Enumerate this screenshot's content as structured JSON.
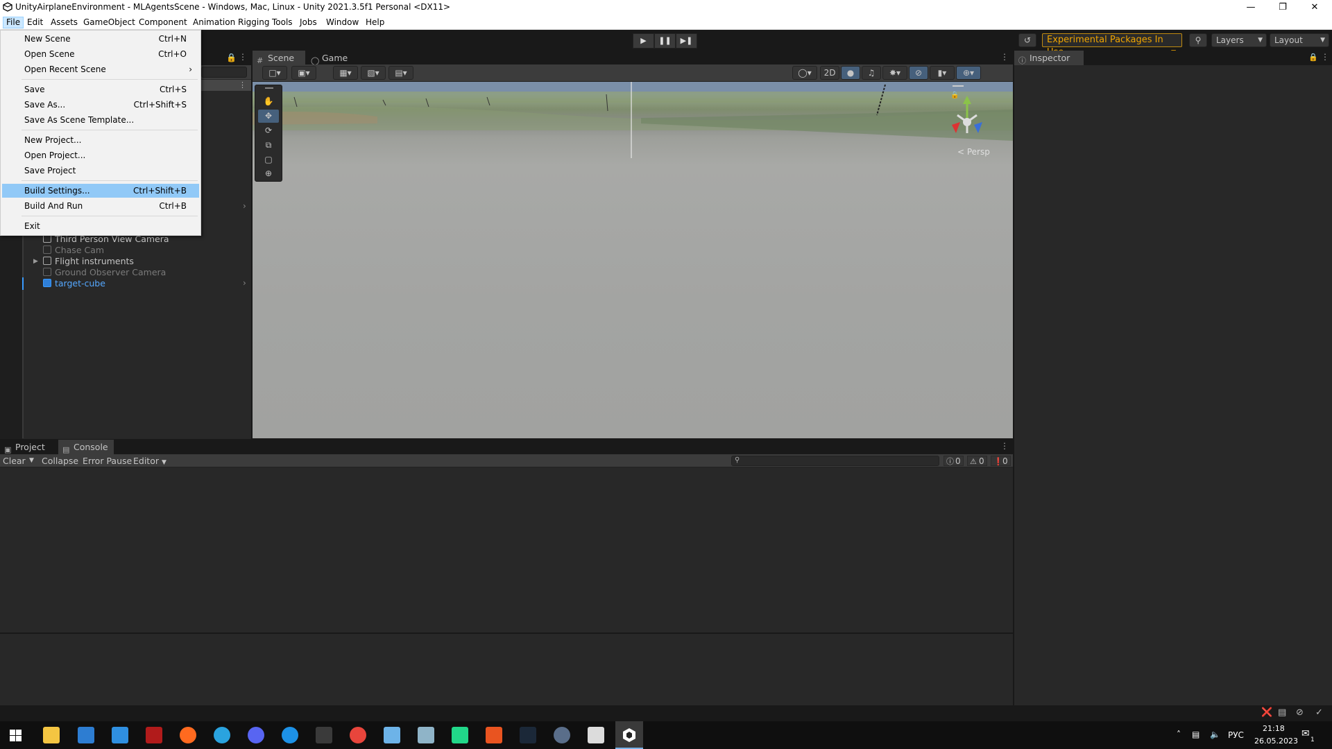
{
  "window": {
    "title": "UnityAirplaneEnvironment - MLAgentsScene - Windows, Mac, Linux - Unity 2021.3.5f1 Personal <DX11>"
  },
  "menubar": {
    "items": [
      "File",
      "Edit",
      "Assets",
      "GameObject",
      "Component",
      "Animation Rigging",
      "Tools",
      "Jobs",
      "Window",
      "Help"
    ]
  },
  "toolbar": {
    "experimental_label": "Experimental Packages In Use",
    "layers_label": "Layers",
    "layout_label": "Layout"
  },
  "file_menu": {
    "items": [
      {
        "label": "New Scene",
        "shortcut": "Ctrl+N"
      },
      {
        "label": "Open Scene",
        "shortcut": "Ctrl+O"
      },
      {
        "label": "Open Recent Scene",
        "shortcut": ""
      },
      {
        "label": "Save",
        "shortcut": "Ctrl+S"
      },
      {
        "label": "Save As...",
        "shortcut": "Ctrl+Shift+S"
      },
      {
        "label": "Save As Scene Template...",
        "shortcut": ""
      },
      {
        "label": "New Project...",
        "shortcut": ""
      },
      {
        "label": "Open Project...",
        "shortcut": ""
      },
      {
        "label": "Save Project",
        "shortcut": ""
      },
      {
        "label": "Build Settings...",
        "shortcut": "Ctrl+Shift+B"
      },
      {
        "label": "Build And Run",
        "shortcut": "Ctrl+B"
      },
      {
        "label": "Exit",
        "shortcut": ""
      }
    ]
  },
  "hierarchy": {
    "items": [
      {
        "label": "Third Person View Camera"
      },
      {
        "label": "Chase Cam"
      },
      {
        "label": "Flight instruments"
      },
      {
        "label": "Ground Observer Camera"
      },
      {
        "label": "target-cube"
      }
    ]
  },
  "scene": {
    "tabs": [
      "Scene",
      "Game"
    ],
    "btn_2d": "2D",
    "persp_label": "< Persp"
  },
  "inspector": {
    "tab": "Inspector"
  },
  "console": {
    "tabs": [
      "Project",
      "Console"
    ],
    "clear": "Clear",
    "collapse": "Collapse",
    "error_pause": "Error Pause",
    "editor": "Editor",
    "count_log": "0",
    "count_warn": "0",
    "count_error": "0"
  },
  "tray": {
    "lang": "РУС",
    "time": "21:18",
    "date": "26.05.2023",
    "notif": "1"
  }
}
